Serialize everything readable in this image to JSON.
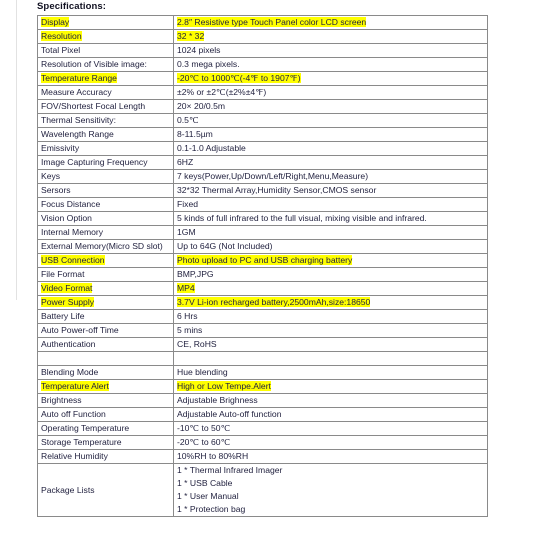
{
  "document": {
    "heading": "Specifications:"
  },
  "table": {
    "rows": [
      {
        "key": "Display",
        "value": "2.8″ Resistive type Touch Panel color LCD screen",
        "key_highlight": true,
        "value_highlight": true
      },
      {
        "key": "Resolution",
        "value": "32 * 32",
        "key_highlight": true,
        "value_highlight": true
      },
      {
        "key": "Total Pixel",
        "value": "1024 pixels",
        "key_highlight": false,
        "value_highlight": false
      },
      {
        "key": "Resolution of Visible image:",
        "value": "0.3 mega pixels.",
        "key_highlight": false,
        "value_highlight": false
      },
      {
        "key": "Temperature Range",
        "value": "-20℃ to 1000℃(-4℉ to 1907℉)",
        "key_highlight": true,
        "value_highlight": true
      },
      {
        "key": "Measure Accuracy",
        "value": "±2% or ±2℃(±2%±4℉)",
        "key_highlight": false,
        "value_highlight": false
      },
      {
        "key": "FOV/Shortest Focal Length",
        "value": " 20× 20/0.5m",
        "key_highlight": false,
        "value_highlight": false
      },
      {
        "key": "Thermal Sensitivity:",
        "value": "0.5℃",
        "key_highlight": false,
        "value_highlight": false
      },
      {
        "key": "Wavelength Range",
        "value": "8-11.5µm",
        "key_highlight": false,
        "value_highlight": false
      },
      {
        "key": "Emissivity",
        "value": "0.1-1.0 Adjustable",
        "key_highlight": false,
        "value_highlight": false
      },
      {
        "key": "Image Capturing Frequency",
        "value": "6HZ",
        "key_highlight": false,
        "value_highlight": false
      },
      {
        "key": "Keys",
        "value": "7 keys(Power,Up/Down/Left/Right,Menu,Measure)",
        "key_highlight": false,
        "value_highlight": false
      },
      {
        "key": "Sersors",
        "value": "32*32 Thermal Array,Humidity Sensor,CMOS sensor",
        "key_highlight": false,
        "value_highlight": false
      },
      {
        "key": "Focus Distance",
        "value": "Fixed",
        "key_highlight": false,
        "value_highlight": false
      },
      {
        "key": "Vision Option",
        "value": "5 kinds of full infrared to the full visual, mixing visible and infrared.",
        "key_highlight": false,
        "value_highlight": false
      },
      {
        "key": "Internal Memory",
        "value": "1GM",
        "key_highlight": false,
        "value_highlight": false
      },
      {
        "key": "External Memory(Micro SD slot)",
        "value": "Up to 64G (Not Included)",
        "key_highlight": false,
        "value_highlight": false
      },
      {
        "key": "USB Connection",
        "value": "Photo upload to PC and USB charging battery",
        "key_highlight": true,
        "value_highlight": true
      },
      {
        "key": "File Format",
        "value": "BMP,JPG",
        "key_highlight": false,
        "value_highlight": false
      },
      {
        "key": "Video Format",
        "value": "MP4",
        "key_highlight": true,
        "value_highlight": true
      },
      {
        "key": "Power Supply",
        "value": "3.7V Li-ion recharged battery,2500mAh,size:18650",
        "key_highlight": true,
        "value_highlight": true
      },
      {
        "key": "Battery Life",
        "value": "6 Hrs",
        "key_highlight": false,
        "value_highlight": false
      },
      {
        "key": "Auto Power-off Time",
        "value": "5 mins",
        "key_highlight": false,
        "value_highlight": false
      },
      {
        "key": "Authentication",
        "value": "CE, RoHS",
        "key_highlight": false,
        "value_highlight": false
      },
      {
        "key": "",
        "value": "",
        "key_highlight": false,
        "value_highlight": false
      },
      {
        "key": "Blending Mode",
        "value": "Hue blending",
        "key_highlight": false,
        "value_highlight": false
      },
      {
        "key": "Temperature Alert",
        "value": "High or Low Tempe.Alert",
        "key_highlight": true,
        "value_highlight": true
      },
      {
        "key": "Brightness",
        "value": "Adjustable Brighness",
        "key_highlight": false,
        "value_highlight": false
      },
      {
        "key": "Auto off Function",
        "value": "Adjustable Auto-off function",
        "key_highlight": false,
        "value_highlight": false
      },
      {
        "key": "Operating Temperature",
        "value": "-10℃ to 50℃",
        "key_highlight": false,
        "value_highlight": false
      },
      {
        "key": "Storage Temperature",
        "value": "-20℃ to 60℃",
        "key_highlight": false,
        "value_highlight": false
      },
      {
        "key": "Relative Humidity",
        "value": "10%RH to 80%RH",
        "key_highlight": false,
        "value_highlight": false
      }
    ],
    "package_row": {
      "key": "Package Lists",
      "lines": [
        "1 * Thermal Infrared Imager",
        "1 * USB Cable",
        "1 * User Manual",
        "1 * Protection bag"
      ]
    }
  },
  "colors": {
    "highlight": "#ffff00",
    "border": "#8a8a8a",
    "text": "#1f1f3d",
    "margin_rule": "#e2e2e2"
  }
}
